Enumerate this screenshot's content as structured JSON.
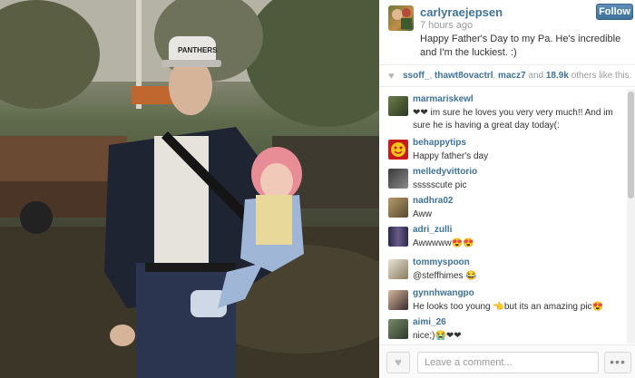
{
  "photo": {
    "alt_subject": "father-holding-baby-photo",
    "cap_text": "PANTHERS"
  },
  "post": {
    "username": "carlyraejepsen",
    "time_ago": "7 hours ago",
    "caption": "Happy Father's Day to my Pa. He's incredible and I'm the luckiest. :)",
    "follow_label": "Follow"
  },
  "likes": {
    "users": [
      "ssoff_",
      "thawt8ovactrl",
      "macz7"
    ],
    "and_text": "and",
    "count": "18.9k",
    "suffix": "others like this."
  },
  "comments": [
    {
      "user": "marmariskewl",
      "text": "❤❤ im sure he loves you very very much!! And im sure he is having a great day today(:"
    },
    {
      "user": "behappytips",
      "text": "Happy father's day"
    },
    {
      "user": "melledyvittorio",
      "text": "ssssscute pic"
    },
    {
      "user": "nadhra02",
      "text": "Aww"
    },
    {
      "user": "adri_zulli",
      "text": "Awwwww😍😍"
    },
    {
      "user": "tommyspoon",
      "text": "@steffhimes 😂"
    },
    {
      "user": "gynnhwangpo",
      "text": "He looks too young 👈but its an amazing pic😍"
    },
    {
      "user": "aimi_26",
      "text": "nice;)😭❤❤"
    }
  ],
  "footer": {
    "comment_placeholder": "Leave a comment...",
    "more_label": "•••"
  },
  "icons": {
    "like": "heart-icon",
    "more": "ellipsis-icon"
  },
  "colors": {
    "link_blue": "#3f729b",
    "follow_button": "#3f729b"
  }
}
